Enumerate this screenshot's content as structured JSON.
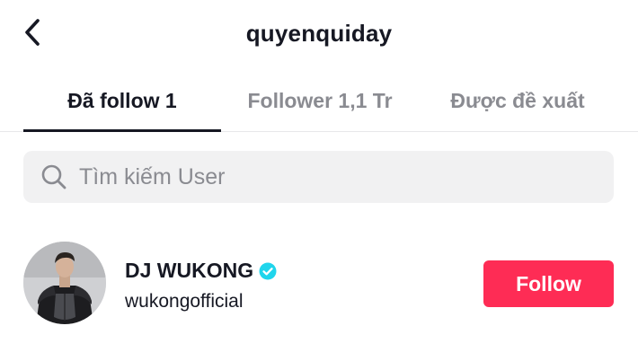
{
  "header": {
    "title": "quyenquiday",
    "back_icon": "chevron-left-icon"
  },
  "tabs": [
    {
      "label": "Đã follow 1",
      "active": true
    },
    {
      "label": "Follower 1,1 Tr",
      "active": false
    },
    {
      "label": "Được đề xuất",
      "active": false
    }
  ],
  "search": {
    "icon": "search-icon",
    "placeholder": "Tìm kiếm User",
    "value": ""
  },
  "users": [
    {
      "name": "DJ WUKONG",
      "verified": true,
      "handle": "wukongofficial",
      "button_label": "Follow"
    }
  ],
  "colors": {
    "accent": "#fe2c55",
    "verified": "#20d5ec",
    "text_primary": "#161823",
    "text_secondary": "#8a8b91",
    "search_bg": "#f1f1f2"
  }
}
